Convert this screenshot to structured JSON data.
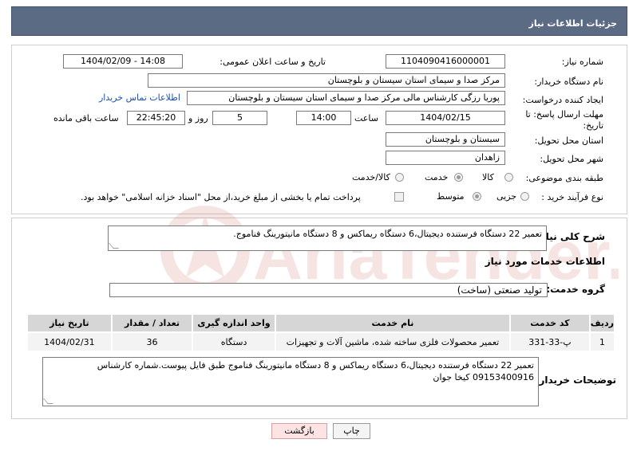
{
  "header": {
    "title": "جزئیات اطلاعات نیاز"
  },
  "form": {
    "need_number_label": "شماره نیاز:",
    "need_number": "1104090416000001",
    "announce_label": "تاریخ و ساعت اعلان عمومی:",
    "announce_value": "1404/02/09 - 14:08",
    "buyer_org_label": "نام دستگاه خریدار:",
    "buyer_org": "مرکز صدا و سیمای استان سیستان و بلوچستان",
    "requester_label": "ایجاد کننده درخواست:",
    "requester": "پوریا رزگی کارشناس مالی مرکز صدا و سیمای استان سیستان و بلوچستان",
    "contact_link": "اطلاعات تماس خریدار",
    "deadline_label_1": "مهلت ارسال پاسخ: تا",
    "deadline_label_2": "تاریخ:",
    "deadline_date": "1404/02/15",
    "time_label": "ساعت",
    "deadline_time": "14:00",
    "days_value": "5",
    "days_label": "روز و",
    "remaining_time": "22:45:20",
    "remaining_label": "ساعت باقی مانده",
    "province_label": "استان محل تحویل:",
    "province": "سیستان و بلوچستان",
    "city_label": "شهر محل تحویل:",
    "city": "زاهدان",
    "category_label": "طبقه بندی موضوعی:",
    "category_options": [
      "کالا",
      "خدمت",
      "کالا/خدمت"
    ],
    "category_selected": "خدمت",
    "process_label": "نوع فرآیند خرید :",
    "process_options": [
      "جزیی",
      "متوسط"
    ],
    "process_selected": "متوسط",
    "treasury_note": "پرداخت تمام یا بخشی از مبلغ خرید،از محل \"اسناد خزانه اسلامی\" خواهد بود."
  },
  "summary": {
    "label": "شرح کلی نیاز:",
    "text": "تعمیر 22 دستگاه فرستنده دیجیتال،6 دستگاه ریماکس و 8 دستگاه مانیتورینگ فناموج."
  },
  "services": {
    "section_title": "اطلاعات خدمات مورد نیاز",
    "group_label": "گروه خدمت:",
    "group_value": "تولید صنعتی (ساخت)",
    "columns": [
      "ردیف",
      "کد خدمت",
      "نام خدمت",
      "واحد اندازه گیری",
      "تعداد / مقدار",
      "تاریخ نیاز"
    ],
    "rows": [
      [
        "1",
        "پ-33-331",
        "تعمیر محصولات فلزی ساخته شده، ماشین آلات و تجهیزات",
        "دستگاه",
        "36",
        "1404/02/31"
      ]
    ]
  },
  "buyer_notes": {
    "label": "توضیحات خریدار:",
    "text": "تعمیر 22 دستگاه فرستنده دیجیتال،6 دستگاه ریماکس و 8 دستگاه مانیتورینگ فناموج طبق فایل پیوست.شماره کارشناس 09153400916 کیخا جوان"
  },
  "buttons": {
    "print": "چاپ",
    "back": "بازگشت"
  },
  "watermark": {
    "text": "AriaTender.net"
  },
  "colors": {
    "header_bg": "#5b6b84",
    "link": "#1a4fb3",
    "back_button_bg": "#fde3e3",
    "watermark": "#c0392b"
  }
}
